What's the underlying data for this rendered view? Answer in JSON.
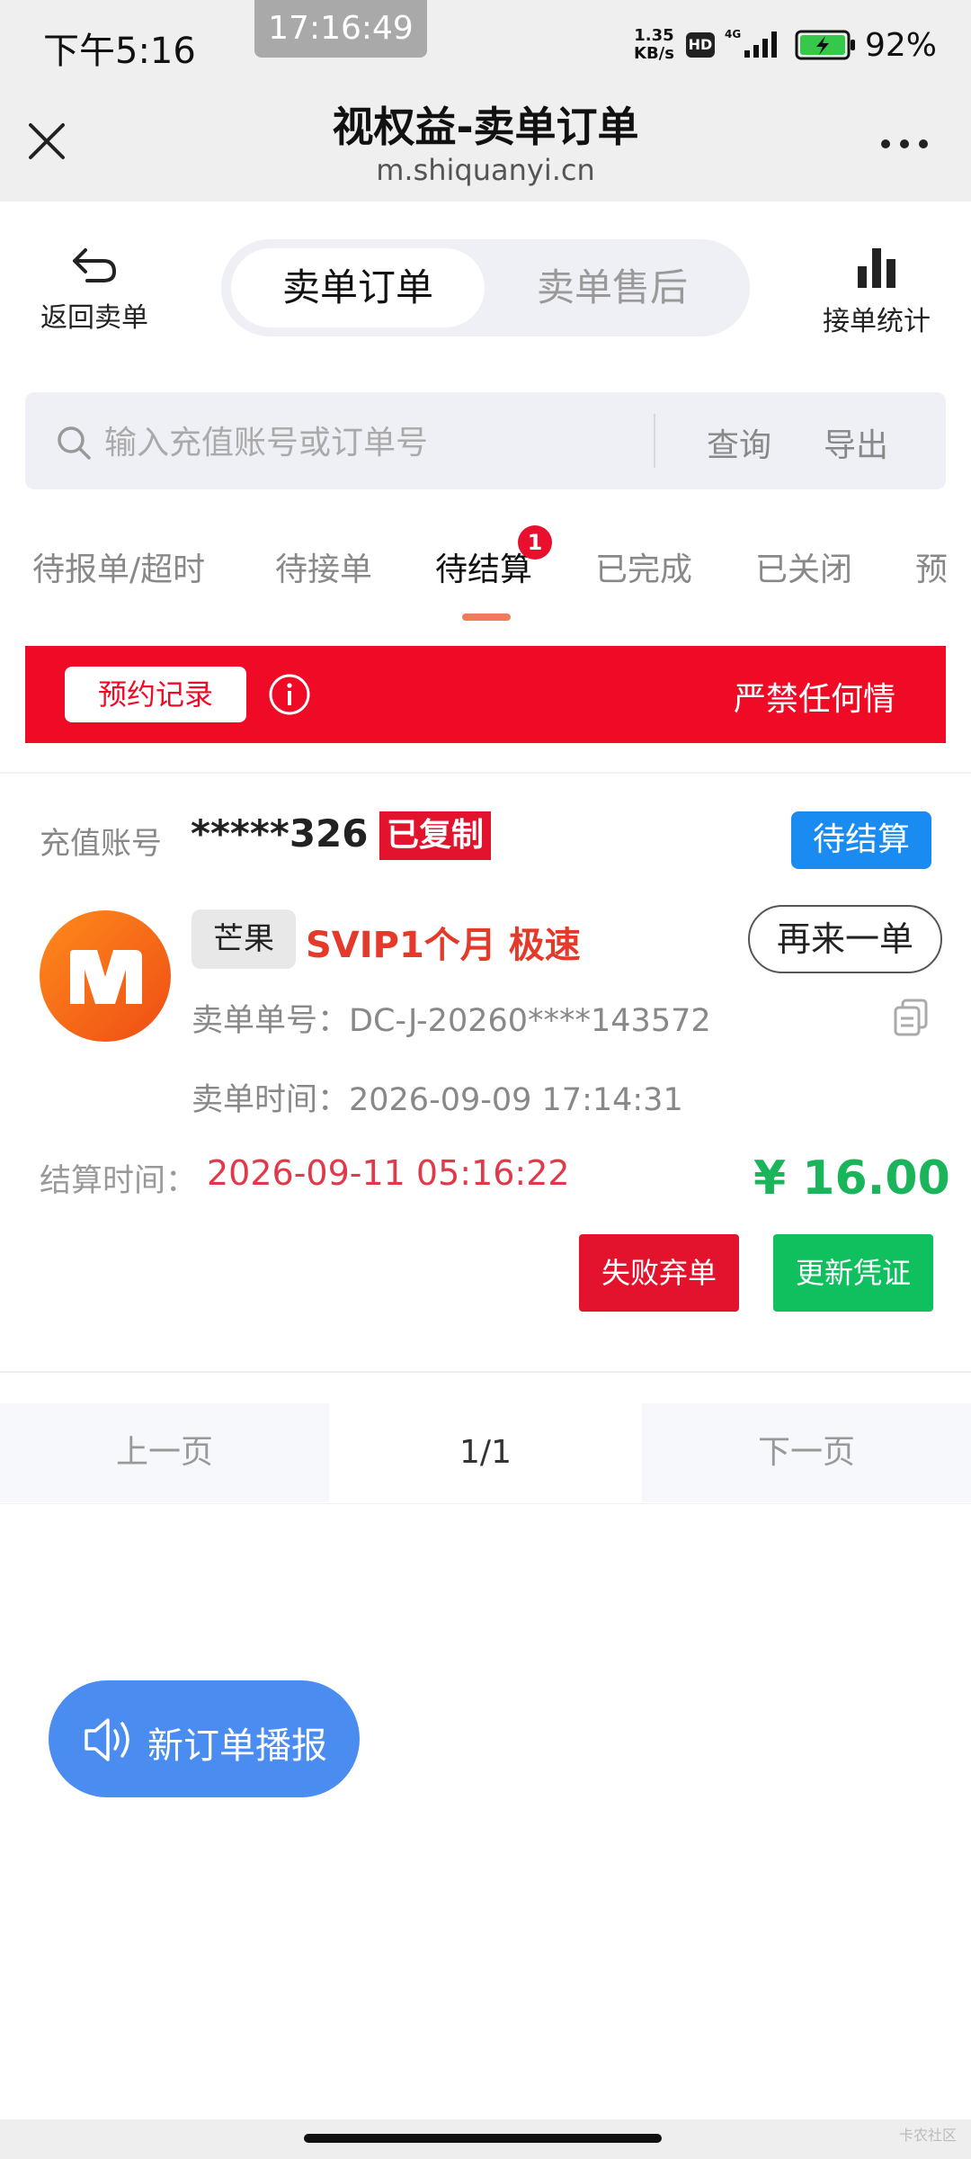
{
  "status_bar": {
    "time": "下午5:16",
    "center_time": "17:16:49",
    "net_speed": "1.35",
    "net_unit": "KB/s",
    "hd": "HD",
    "network": "4G",
    "battery": "92%"
  },
  "title_bar": {
    "title": "视权益-卖单订单",
    "url": "m.shiquanyi.cn"
  },
  "top_nav": {
    "back_label": "返回卖单",
    "segments": [
      "卖单订单",
      "卖单售后"
    ],
    "stats_label": "接单统计"
  },
  "search": {
    "placeholder": "输入充值账号或订单号",
    "query_label": "查询",
    "export_label": "导出"
  },
  "status_tabs": {
    "items": [
      "待报单/超时",
      "待接单",
      "待结算",
      "已完成",
      "已关闭",
      "预"
    ],
    "active_badge": "1"
  },
  "notice": {
    "button_label": "预约记录",
    "text": "严禁任何情"
  },
  "order": {
    "account_label": "充值账号",
    "account_value": "*****326",
    "copied_badge": "已复制",
    "status": "待结算",
    "platform": "芒果",
    "product": "SVIP1个月 极速",
    "reorder_label": "再来一单",
    "order_no": "卖单单号：DC-J-20260****143572",
    "order_time": "卖单时间：2026-09-09 17:14:31",
    "settle_label": "结算时间：",
    "settle_value": "2026-09-11 05:16:22",
    "price": "¥ 16.00",
    "fail_label": "失败弃单",
    "update_label": "更新凭证",
    "colors": {
      "logo": "#f26b1d",
      "price": "#1ab55a",
      "danger": "#e3132d",
      "status": "#1a8bf0"
    }
  },
  "pagination": {
    "prev": "上一页",
    "current": "1/1",
    "next": "下一页"
  },
  "broadcast": {
    "label": "新订单播报"
  },
  "watermark": "卡农社区"
}
